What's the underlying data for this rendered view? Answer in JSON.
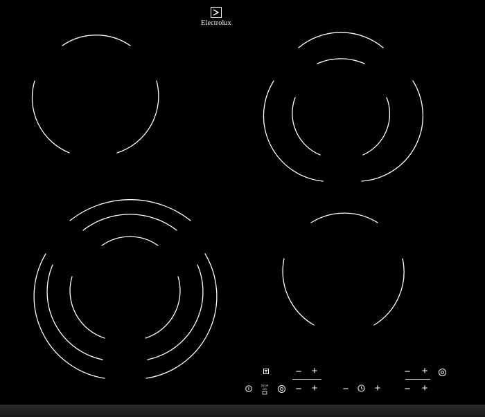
{
  "brand": {
    "name": "Electrolux",
    "icon": "electrolux-logo-icon"
  },
  "cooktop": {
    "type": "ceramic hob",
    "zones": [
      "single zone (rear left)",
      "dual zone (rear right)",
      "triple zone (front left)",
      "single zone (front right)"
    ]
  },
  "controls": {
    "minus": "−",
    "plus": "+",
    "stop_label": "STOP\nGO",
    "icons": [
      "power-icon",
      "lock-icon",
      "timer-icon",
      "stop-go-icon",
      "bridge-icon"
    ]
  },
  "colors": {
    "glass": "#000000",
    "lines": "#ffffff",
    "frame": "#222222"
  }
}
